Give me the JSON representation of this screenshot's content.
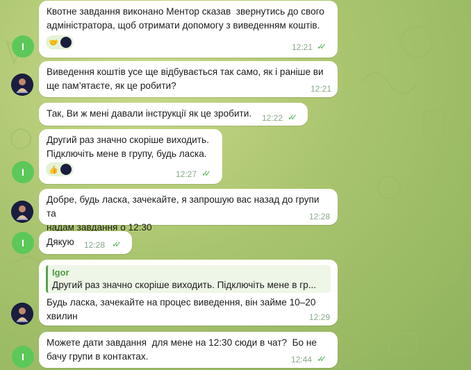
{
  "colors": {
    "accent": "#4fae4e",
    "bubble": "#ffffff",
    "avatar_user": "#5cc85a",
    "avatar_bot": "#1a1d3f"
  },
  "user_avatar_letter": "I",
  "messages": [
    {
      "text": "Квотне завдання виконано Ментор сказав  звернутись до свого\nадміністратора, щоб отримати допомогу з виведенням коштів.",
      "time": "12:21",
      "reactions": [
        "🤝"
      ]
    },
    {
      "text": "Виведення коштів усе ще відбувається так само, як і раніше ви\nще пам’ятаєте, як це робити?",
      "time": "12:21"
    },
    {
      "text": "Так, Ви ж мені давали інструкції як це зробити.",
      "time": "12:22"
    },
    {
      "text": "Другий раз значно скоріше виходить.\nПідключіть мене в групу, будь ласка.",
      "time": "12:27",
      "reactions": [
        "👍"
      ]
    },
    {
      "text": "Добре, будь ласка, зачекайте, я запрошую вас назад до групи та\nнадам завдання о 12:30",
      "time": "12:28"
    },
    {
      "text": "Дякую",
      "time": "12:28"
    },
    {
      "quote_name": "Igor",
      "quote_text": "Другий раз значно скоріше виходить. Підключіть мене в гр...",
      "text": "Будь ласка, зачекайте на процес виведення, він займе 10–20\nхвилин",
      "time": "12:29"
    },
    {
      "text": "Можете дати завдання  для мене на 12:30 сюди в чат?  Бо не\nбачу групи в контактах.",
      "time": "12:44"
    }
  ]
}
